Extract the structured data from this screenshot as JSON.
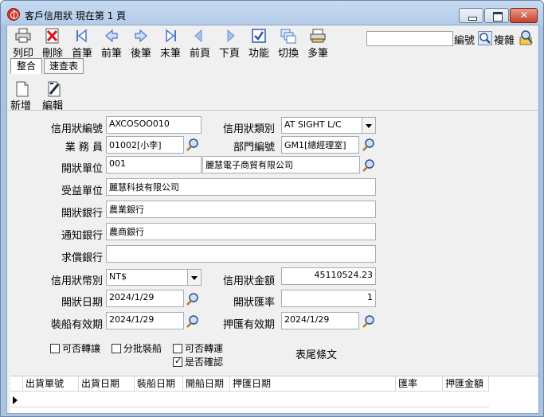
{
  "window": {
    "title": "客戶信用狀  現在第 1 頁"
  },
  "toolbar": {
    "buttons": [
      {
        "label": "列印",
        "icon": "printer-icon"
      },
      {
        "label": "刪除",
        "icon": "delete-icon"
      },
      {
        "label": "首筆",
        "icon": "first-record-icon"
      },
      {
        "label": "前筆",
        "icon": "prev-record-icon"
      },
      {
        "label": "後筆",
        "icon": "next-record-icon"
      },
      {
        "label": "末筆",
        "icon": "last-record-icon"
      },
      {
        "label": "前頁",
        "icon": "prev-page-icon"
      },
      {
        "label": "下頁",
        "icon": "next-page-icon"
      },
      {
        "label": "功能",
        "icon": "function-icon"
      },
      {
        "label": "切換",
        "icon": "switch-icon"
      },
      {
        "label": "多筆",
        "icon": "multi-record-icon"
      }
    ],
    "search_value": "",
    "code_label": "編號",
    "complex_label": "複雜"
  },
  "tabs": [
    {
      "label": "整合",
      "active": true
    },
    {
      "label": "速查表",
      "active": false
    }
  ],
  "actions": {
    "new_label": "新增",
    "edit_label": "編輯"
  },
  "form": {
    "lc_no_label": "信用狀編號",
    "lc_no_value": "AXCOSOO010",
    "lc_type_label": "信用狀類別",
    "lc_type_value": "AT SIGHT L/C",
    "salesman_label": "業 務 員",
    "salesman_value": "01002[小李]",
    "dept_label": "部門編號",
    "dept_value": "GM1[總經理室]",
    "issuer_label": "開狀單位",
    "issuer_code": "001",
    "issuer_name": "麗慧電子商貿有限公司",
    "beneficiary_label": "受益單位",
    "beneficiary_value": "麗慧科技有限公司",
    "issuing_bank_label": "開狀銀行",
    "issuing_bank_value": "農業銀行",
    "advising_bank_label": "通知銀行",
    "advising_bank_value": "農商銀行",
    "reimbursing_bank_label": "求償銀行",
    "reimbursing_bank_value": "",
    "currency_label": "信用狀幣別",
    "currency_value": "NT$",
    "amount_label": "信用狀金額",
    "amount_value": "45110524.23",
    "open_date_label": "開狀日期",
    "open_date_value": "2024/1/29",
    "rate_label": "開狀匯率",
    "rate_value": "1",
    "ship_expiry_label": "裝船有效期",
    "ship_expiry_value": "2024/1/29",
    "nego_expiry_label": "押匯有效期",
    "nego_expiry_value": "2024/1/29",
    "checkboxes": [
      {
        "label": "可否轉讓",
        "checked": false
      },
      {
        "label": "分批裝船",
        "checked": false
      },
      {
        "label": "可否轉運",
        "checked": false
      },
      {
        "label": "是否確認",
        "checked": true
      }
    ],
    "footer_terms_label": "表尾條文"
  },
  "grid": {
    "columns": [
      "出貨單號",
      "出貨日期",
      "裝船日期",
      "開船日期",
      "押匯日期",
      "匯率",
      "押匯金額"
    ]
  },
  "colors": {
    "window_frame": "#a9c4e3",
    "client_bg": "#f0f0f0"
  }
}
